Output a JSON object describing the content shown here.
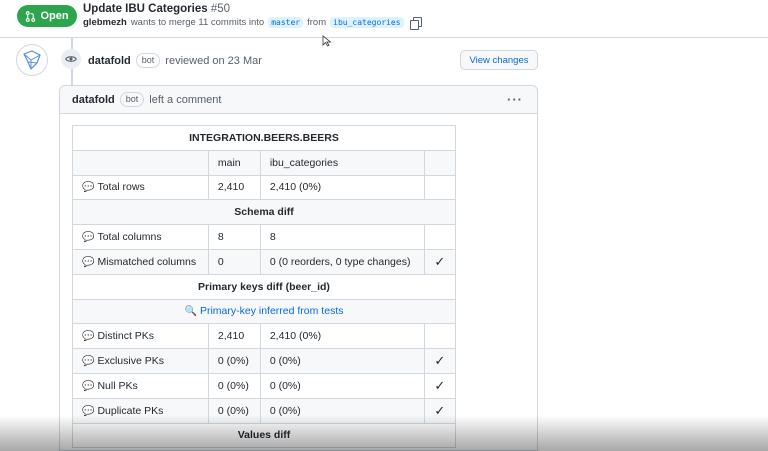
{
  "header": {
    "status": "Open",
    "title": "Update IBU Categories",
    "number": "#50",
    "author": "glebmezh",
    "merge_text": "wants to merge 11 commits into",
    "base_branch": "master",
    "from_text": "from",
    "head_branch": "ibu_categories"
  },
  "review": {
    "author": "datafold",
    "bot": "bot",
    "text": "reviewed on 23 Mar",
    "view_changes": "View changes"
  },
  "comment": {
    "author": "datafold",
    "bot": "bot",
    "action": "left a comment",
    "menu": "···"
  },
  "table": {
    "title": "INTEGRATION.BEERS.BEERS",
    "col_main": "main",
    "col_branch": "ibu_categories",
    "total_rows": {
      "label": "Total rows",
      "main": "2,410",
      "branch": "2,410 (0%)",
      "check": ""
    },
    "schema_diff": "Schema diff",
    "total_columns": {
      "label": "Total columns",
      "main": "8",
      "branch": "8",
      "check": ""
    },
    "mismatched_columns": {
      "label": "Mismatched columns",
      "main": "0",
      "branch": "0 (0 reorders, 0 type changes)",
      "check": "✓"
    },
    "pk_diff": "Primary keys diff (beer_id)",
    "pk_inferred": "Primary-key inferred from tests",
    "distinct_pks": {
      "label": "Distinct PKs",
      "main": "2,410",
      "branch": "2,410 (0%)",
      "check": ""
    },
    "exclusive_pks": {
      "label": "Exclusive PKs",
      "main": "0 (0%)",
      "branch": "0 (0%)",
      "check": "✓"
    },
    "null_pks": {
      "label": "Null PKs",
      "main": "0 (0%)",
      "branch": "0 (0%)",
      "check": "✓"
    },
    "duplicate_pks": {
      "label": "Duplicate PKs",
      "main": "0 (0%)",
      "branch": "0 (0%)",
      "check": "✓"
    },
    "values_diff": "Values diff"
  },
  "colors": {
    "open_green": "#2da44e",
    "link_blue": "#0969da",
    "border": "#d0d7de"
  },
  "icons": {
    "status": "git-pull-request-icon",
    "copy": "copy-icon",
    "eye": "eye-icon",
    "comment": "comment-bubble-icon",
    "search": "magnifier-icon",
    "check": "check-icon"
  }
}
